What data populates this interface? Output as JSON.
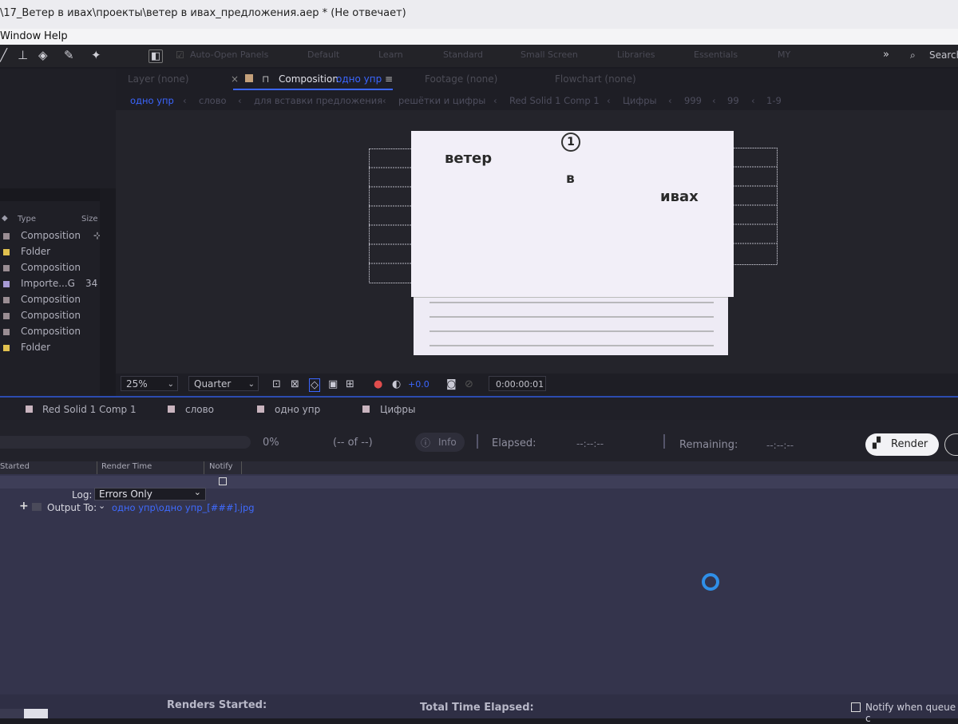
{
  "window": {
    "title": "\\17_Ветер в ивах\\проекты\\ветер в ивах_предложения.aep * (Не отвечает)"
  },
  "menu": {
    "items": [
      "Window",
      "Help"
    ]
  },
  "toolbar": {
    "auto_open_panels": "Auto-Open Panels",
    "workspaces": [
      "Default",
      "Learn",
      "Standard",
      "Small Screen",
      "Libraries",
      "Essentials",
      "MY"
    ],
    "search": "Search"
  },
  "panel_tabs": {
    "layer": "Layer (none)",
    "composition_prefix": "Composition",
    "composition_name": "одно упр",
    "footage": "Footage (none)",
    "flowchart": "Flowchart (none)"
  },
  "breadcrumbs": [
    "одно упр",
    "слово",
    "для вставки предложения",
    "решётки и цифры",
    "Red Solid 1 Comp 1",
    "Цифры",
    "999",
    "99",
    "1-9"
  ],
  "project": {
    "header_type": "Type",
    "header_size": "Size",
    "rows": [
      {
        "type": "Composition",
        "size": "",
        "color": "#9a8d93"
      },
      {
        "type": "Folder",
        "size": "",
        "color": "#e1c14f"
      },
      {
        "type": "Composition",
        "size": "",
        "color": "#9a8d93"
      },
      {
        "type": "Importe...G",
        "size": "34",
        "color": "#a79ad6"
      },
      {
        "type": "Composition",
        "size": "",
        "color": "#9a8d93"
      },
      {
        "type": "Composition",
        "size": "",
        "color": "#9a8d93"
      },
      {
        "type": "Composition",
        "size": "",
        "color": "#9a8d93"
      },
      {
        "type": "Folder",
        "size": "",
        "color": "#e1c14f"
      }
    ]
  },
  "canvas": {
    "number": "1",
    "word1": "ветер",
    "word2": "в",
    "word3": "ивах"
  },
  "viewer_controls": {
    "zoom": "25%",
    "resolution": "Quarter",
    "exposure": "+0.0",
    "timecode": "0:00:00:01"
  },
  "render_tabs": [
    "Red Solid 1 Comp 1",
    "слово",
    "одно упр",
    "Цифры"
  ],
  "render": {
    "percent": "0%",
    "count": "(-- of --)",
    "info": "Info",
    "elapsed_label": "Elapsed:",
    "elapsed_value": "--:--:--",
    "remaining_label": "Remaining:",
    "remaining_value": "--:--:--",
    "render_button": "Render",
    "columns": [
      "Started",
      "Render Time",
      "Notify"
    ],
    "log_label": "Log:",
    "log_value": "Errors Only",
    "output_label": "Output To:",
    "output_value": "одно упр\\одно упр_[###].jpg"
  },
  "status": {
    "renders_started": "Renders Started:",
    "total_time": "Total Time Elapsed:",
    "notify": "Notify when queue c"
  },
  "colors": {
    "accent": "#3b66ff",
    "link": "#3f6bff",
    "loading": "#2f8fe8"
  }
}
